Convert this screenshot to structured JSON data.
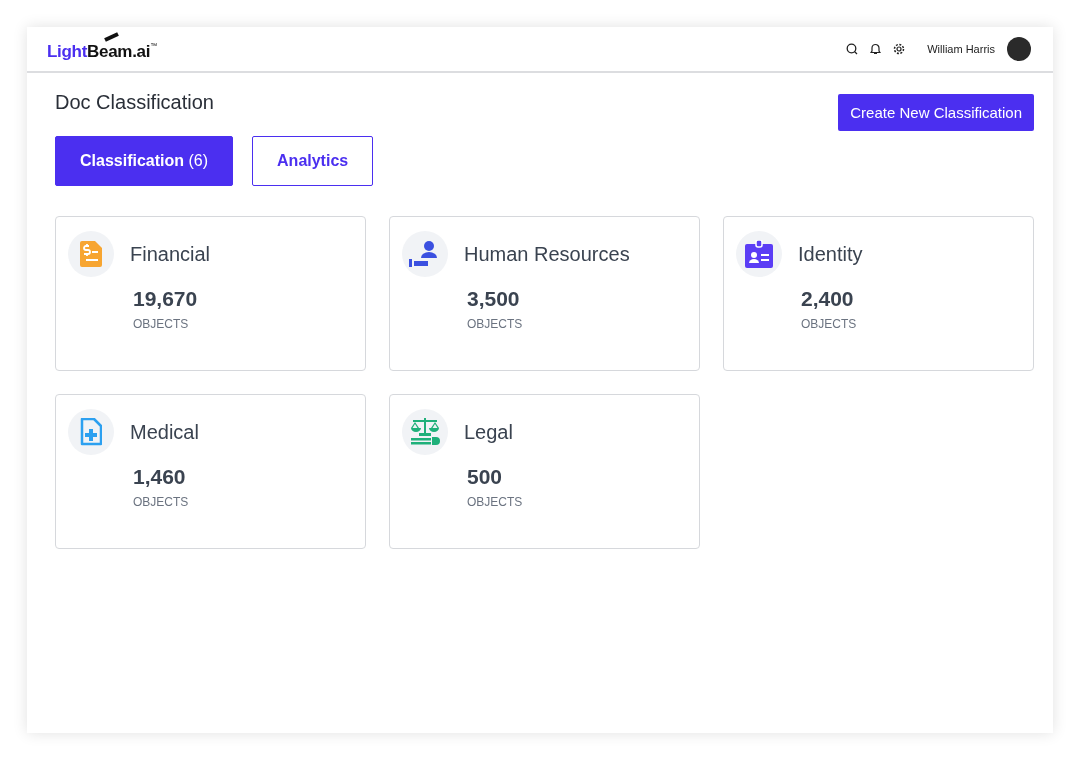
{
  "header": {
    "logo": {
      "accent": "Light",
      "main": "Beam.ai",
      "trademark": "™"
    },
    "user": {
      "name": "William Harris"
    }
  },
  "page": {
    "title": "Doc Classification",
    "action": "Create New Classification"
  },
  "tabs": [
    {
      "label": "Classification",
      "count": "(6)",
      "selected": true
    },
    {
      "label": "Analytics",
      "selected": false
    }
  ],
  "categories": [
    {
      "kind": "financial",
      "color": "#f7a531",
      "name": "Financial",
      "count": "19,670",
      "unit": "OBJECTS"
    },
    {
      "kind": "people",
      "color": "#3b50e0",
      "name": "Human Resources",
      "count": "3,500",
      "unit": "OBJECTS"
    },
    {
      "kind": "identity",
      "color": "#5b3df5",
      "name": "Identity",
      "count": "2,400",
      "unit": "OBJECTS"
    },
    {
      "kind": "medical",
      "color": "#2ca0f0",
      "name": "Medical",
      "count": "1,460",
      "unit": "OBJECTS"
    },
    {
      "kind": "legal",
      "color": "#1fb07a",
      "name": "Legal",
      "count": "500",
      "unit": "OBJECTS"
    }
  ]
}
